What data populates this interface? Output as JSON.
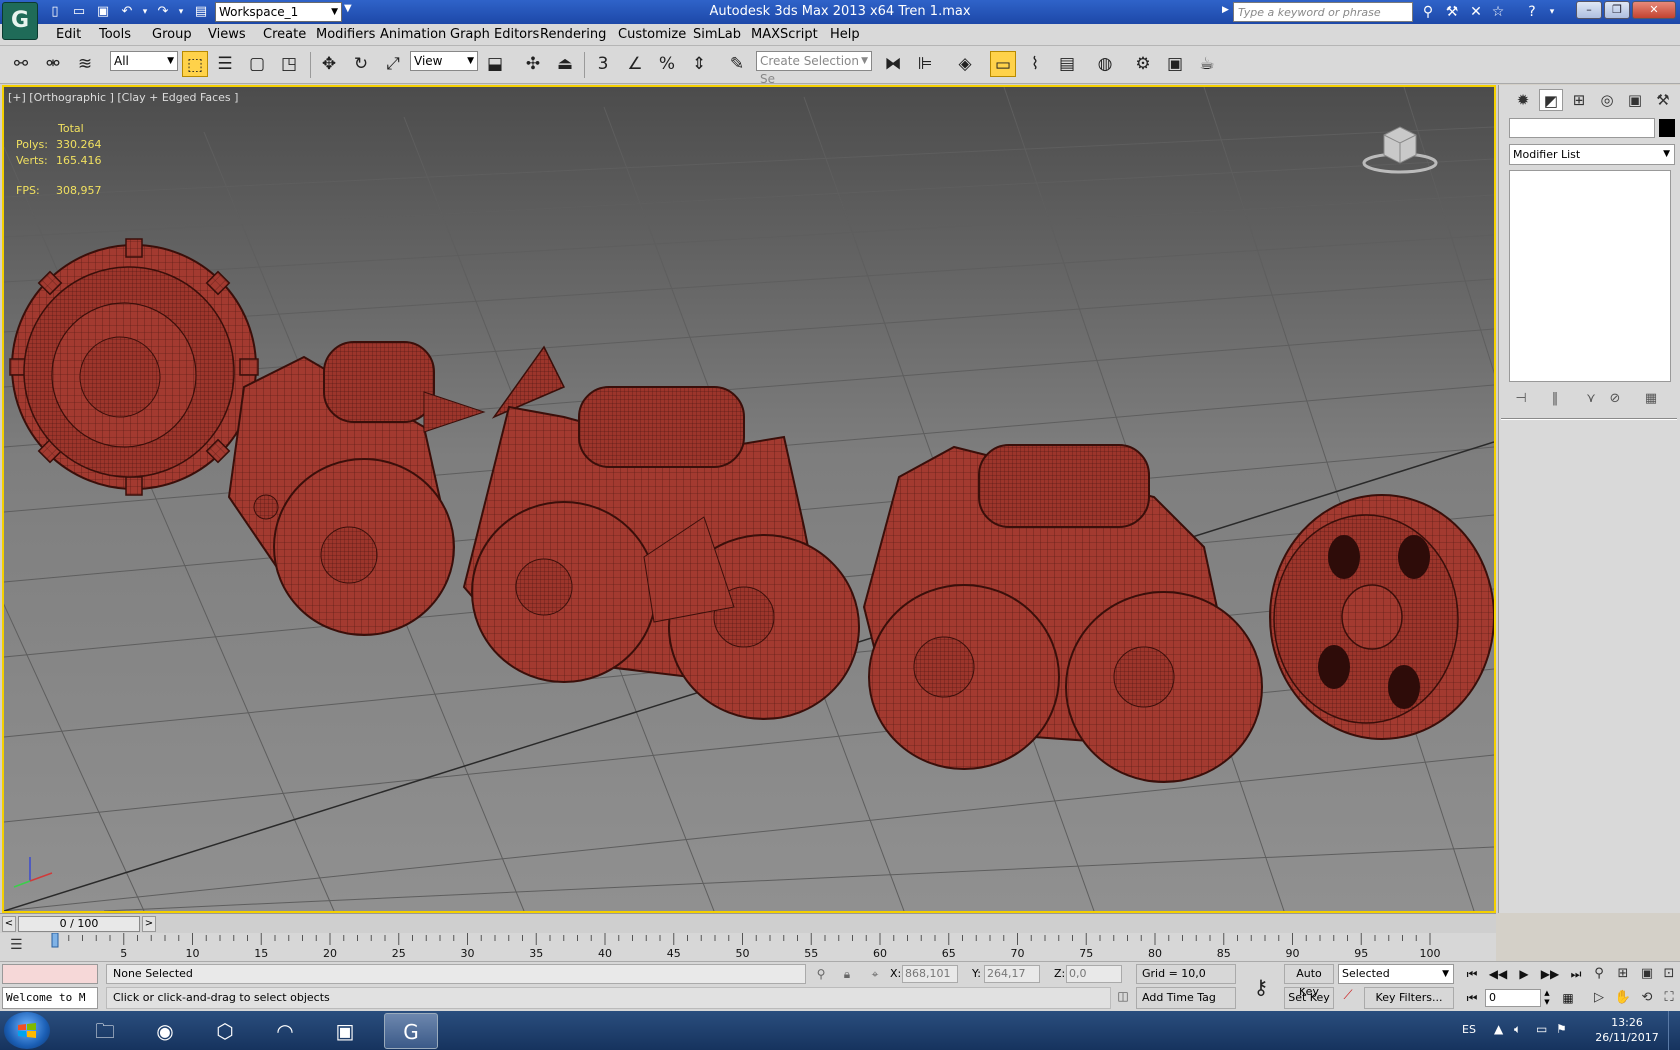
{
  "titlebar": {
    "workspace": "Workspace_1",
    "app_title": "Autodesk 3ds Max  2013 x64      Tren 1.max",
    "search_placeholder": "Type a keyword or phrase"
  },
  "menu": [
    "Edit",
    "Tools",
    "Group",
    "Views",
    "Create",
    "Modifiers",
    "Animation",
    "Graph Editors",
    "Rendering",
    "Customize",
    "SimLab",
    "MAXScript",
    "Help"
  ],
  "toolbar": {
    "filter": "All",
    "ref_coord": "View",
    "selection_set_placeholder": "Create Selection Se"
  },
  "viewport": {
    "label": "[+] [Orthographic ] [Clay + Edged Faces ]",
    "stats": {
      "total_label": "Total",
      "polys_label": "Polys:",
      "polys": "330.264",
      "verts_label": "Verts:",
      "verts": "165.416",
      "fps_label": "FPS:",
      "fps": "308,957"
    },
    "model_color": "#a33a30"
  },
  "command_panel": {
    "modifier_list": "Modifier List"
  },
  "timeline": {
    "position": "0 / 100",
    "ticks": [
      5,
      10,
      15,
      20,
      25,
      30,
      35,
      40,
      45,
      50,
      55,
      60,
      65,
      70,
      75,
      80,
      85,
      90,
      95,
      100
    ]
  },
  "status": {
    "listener": "Welcome to M",
    "selection": "None Selected",
    "prompt": "Click or click-and-drag to select objects",
    "x_label": "X:",
    "x": "868,101",
    "y_label": "Y:",
    "y": "264,17",
    "z_label": "Z:",
    "z": "0,0",
    "grid": "Grid = 10,0",
    "add_time_tag": "Add Time Tag",
    "auto_key": "Auto Key",
    "set_key": "Set Key",
    "key_mode": "Selected",
    "key_filters": "Key Filters...",
    "frame": "0"
  },
  "taskbar": {
    "language": "ES",
    "time": "13:26",
    "date": "26/11/2017"
  }
}
